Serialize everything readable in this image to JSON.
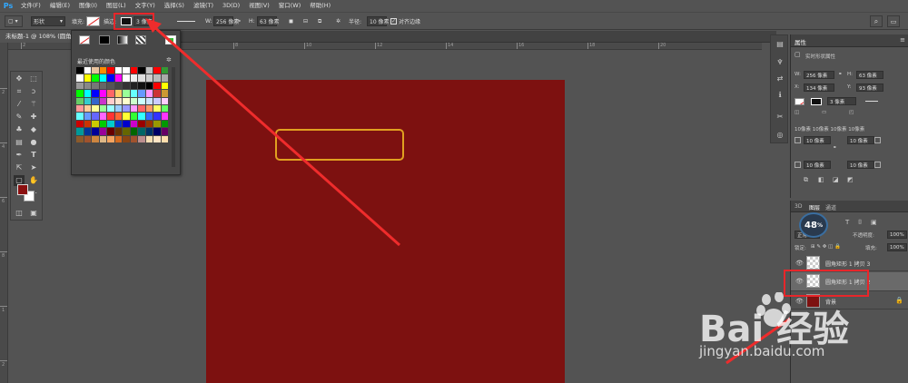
{
  "app": {
    "logo": "Ps"
  },
  "menu": [
    "文件(F)",
    "编辑(E)",
    "图像(I)",
    "图层(L)",
    "文字(Y)",
    "选择(S)",
    "滤镜(T)",
    "3D(D)",
    "视图(V)",
    "窗口(W)",
    "帮助(H)"
  ],
  "options": {
    "mode": "形状",
    "fill_label": "填充:",
    "stroke_label": "描边:",
    "stroke_width": "3 像素",
    "w_label": "W:",
    "w_value": "256 像素",
    "h_label": "H:",
    "h_value": "63 像素",
    "radius_label": "半径:",
    "radius_value": "10 像素",
    "align_edges": "对齐边缘"
  },
  "document": {
    "tab_title": "未标题-1 @ 108% (圆角"
  },
  "ruler_top": [
    "2",
    "4",
    "6",
    "8",
    "10",
    "12",
    "14",
    "16",
    "18",
    "20"
  ],
  "ruler_left": [
    "2",
    "4",
    "6",
    "8",
    "1",
    "2"
  ],
  "swatch_popup": {
    "recent_label": "最近使用的颜色",
    "colors": [
      "#000000",
      "#ffffff",
      "#e8c39e",
      "#ff8c00",
      "#ff0000",
      "#ffffff",
      "#ffffff",
      "#ff0000",
      "#000000",
      "#c0c0c0",
      "#ff0000",
      "#339933",
      "#ffffff",
      "#ffff00",
      "#00ff00",
      "#00ffff",
      "#0000ff",
      "#ff00ff",
      "#ffffff",
      "#eeeeee",
      "#dddddd",
      "#cccccc",
      "#bbbbbb",
      "#aaaaaa",
      "#999999",
      "#888888",
      "#777777",
      "#666666",
      "#555555",
      "#444444",
      "#333333",
      "#222222",
      "#111111",
      "#000000",
      "#ff0000",
      "#ffff00",
      "#00ff00",
      "#00ffff",
      "#0000ff",
      "#ff00ff",
      "#ff6666",
      "#ffcc66",
      "#99ff99",
      "#66ffff",
      "#6699ff",
      "#ff99ff",
      "#cc3333",
      "#cc9933",
      "#66cc66",
      "#33cccc",
      "#3366cc",
      "#cc33cc",
      "#ffcccc",
      "#ffe5cc",
      "#ffffcc",
      "#ccffcc",
      "#ccffff",
      "#cce5ff",
      "#ccccff",
      "#ffccff",
      "#ff9999",
      "#ffcc99",
      "#ffff99",
      "#99ff99",
      "#99ffff",
      "#99ccff",
      "#9999ff",
      "#ff99ff",
      "#ff6666",
      "#ff9966",
      "#ffff66",
      "#66ff66",
      "#66ffff",
      "#6699ff",
      "#6666ff",
      "#ff66ff",
      "#ff3333",
      "#ff6633",
      "#ffff33",
      "#33ff33",
      "#33ffff",
      "#3366ff",
      "#3333ff",
      "#ff33ff",
      "#cc0000",
      "#cc3300",
      "#cccc00",
      "#00cc00",
      "#00cccc",
      "#0033cc",
      "#0000cc",
      "#cc00cc",
      "#990000",
      "#993300",
      "#999900",
      "#009900",
      "#009999",
      "#003399",
      "#000099",
      "#990099",
      "#660000",
      "#663300",
      "#666600",
      "#006600",
      "#006666",
      "#003366",
      "#000066",
      "#660066",
      "#8b5a2b",
      "#a0522d",
      "#cd853f",
      "#deb887",
      "#f4a460",
      "#d2691e",
      "#8b4513",
      "#a0522d",
      "#bc8f8f",
      "#f5deb3",
      "#ffe4c4",
      "#ffdead"
    ]
  },
  "properties": {
    "tab": "属性",
    "title": "实时形状属性",
    "w_label": "W:",
    "w": "256 像素",
    "h_label": "H:",
    "h": "63 像素",
    "x_label": "X:",
    "x": "134 像素",
    "y_label": "Y:",
    "y": "93 像素",
    "stroke": "3 像素",
    "radii": "10像素 10像素 10像素 10像素",
    "r1": "10 像素",
    "r2": "10 像素",
    "r3": "10 像素",
    "r4": "10 像素"
  },
  "layers": {
    "tabs": [
      "3D",
      "图层",
      "通道"
    ],
    "blend": "正常",
    "opacity_label": "不透明度:",
    "opacity": "100%",
    "lock_label": "锁定:",
    "fill_label": "填充:",
    "fill": "100%",
    "items": [
      {
        "name": "圆角矩形 1 拷贝 3"
      },
      {
        "name": "圆角矩形 1 拷贝 2"
      },
      {
        "name": "背景"
      }
    ]
  },
  "badge": {
    "value": "48",
    "unit": "%"
  },
  "watermark": {
    "brand": "Bai 经验",
    "url": "jingyan.baidu.com"
  }
}
